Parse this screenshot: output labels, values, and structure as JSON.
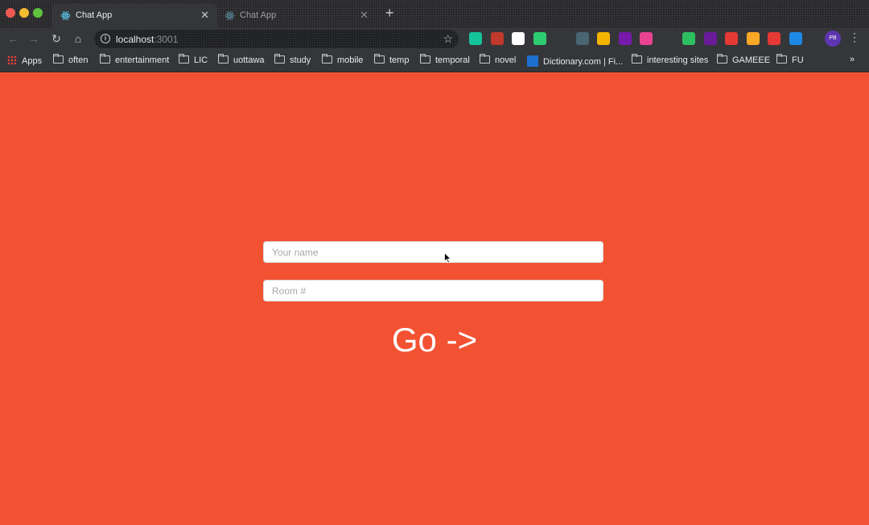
{
  "browser": {
    "tabs": [
      {
        "title": "Chat App",
        "active": true
      },
      {
        "title": "Chat App",
        "active": false
      }
    ],
    "address": {
      "host": "localhost",
      "port": ":3001"
    },
    "extensions": [
      {
        "name": "grammarly-icon",
        "color": "#15c39a"
      },
      {
        "name": "video-recorder-icon",
        "color": "#c0392b"
      },
      {
        "name": "notion-icon",
        "color": "#ffffff"
      },
      {
        "name": "target-icon",
        "color": "#2ecc71"
      },
      {
        "name": "x-extension-icon",
        "color": "#35363a"
      },
      {
        "name": "dev-icon",
        "color": "#4a6572"
      },
      {
        "name": "chrome-ext-icon",
        "color": "#f4b400"
      },
      {
        "name": "onenote-icon",
        "color": "#7719aa"
      },
      {
        "name": "colorzilla-icon",
        "color": "#e84393"
      },
      {
        "name": "pocket-icon",
        "color": "#35363a"
      },
      {
        "name": "evernote-icon",
        "color": "#2dbe60"
      },
      {
        "name": "ap-icon",
        "color": "#6a1b9a"
      },
      {
        "name": "heart-icon",
        "color": "#e53935"
      },
      {
        "name": "play-icon",
        "color": "#f9a825"
      },
      {
        "name": "compass-icon",
        "color": "#e53935"
      },
      {
        "name": "shield-icon",
        "color": "#1e88e5"
      }
    ],
    "profile_initials": "PB",
    "bookmarks": [
      {
        "label": "Apps",
        "kind": "apps"
      },
      {
        "label": "often",
        "kind": "folder"
      },
      {
        "label": "entertainment",
        "kind": "folder"
      },
      {
        "label": "LIC",
        "kind": "folder"
      },
      {
        "label": "uottawa",
        "kind": "folder"
      },
      {
        "label": "study",
        "kind": "folder"
      },
      {
        "label": "mobile",
        "kind": "folder"
      },
      {
        "label": "temp",
        "kind": "folder"
      },
      {
        "label": "temporal",
        "kind": "folder"
      },
      {
        "label": "novel",
        "kind": "folder"
      },
      {
        "label": "Dictionary.com | Fi...",
        "kind": "site"
      },
      {
        "label": "interesting sites",
        "kind": "folder"
      },
      {
        "label": "GAMEEE",
        "kind": "folder"
      },
      {
        "label": "FU",
        "kind": "folder"
      }
    ],
    "more_label": "»"
  },
  "page": {
    "background": "#f25232",
    "name_input": {
      "placeholder": "Your name",
      "value": ""
    },
    "room_input": {
      "placeholder": "Room #",
      "value": ""
    },
    "go_label": "Go ->"
  }
}
